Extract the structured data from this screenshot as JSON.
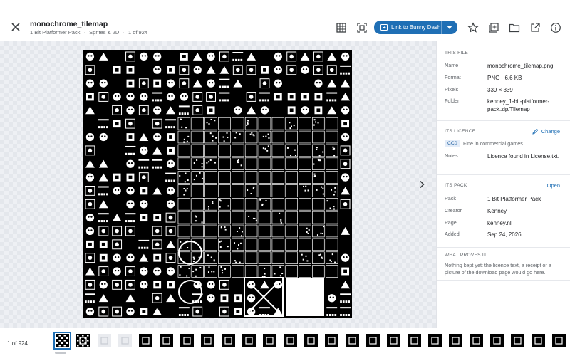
{
  "header": {
    "title": "monochrome_tilemap",
    "subtitle_parts": [
      "1 Bit Platformer Pack",
      "·",
      "Sprites & 2D",
      "·",
      "1 of 924"
    ],
    "link_button_label": "Link to Bunny Dash"
  },
  "icons": {
    "close": "close-icon",
    "grid": "grid-icon",
    "fit": "fit-screen-icon",
    "link": "link-icon",
    "caret": "chevron-down-icon",
    "star": "star-icon",
    "copy": "collection-icon",
    "folder": "folder-icon",
    "open_external": "open-external-icon",
    "info": "info-icon",
    "next": "chevron-right-icon",
    "edit": "pencil-icon"
  },
  "panel": {
    "this_file": {
      "heading": "THIS FILE",
      "rows": [
        {
          "key": "Name",
          "value": "monochrome_tilemap.png"
        },
        {
          "key": "Format",
          "value": "PNG · 6.6 KB"
        },
        {
          "key": "Pixels",
          "value": "339 × 339"
        },
        {
          "key": "Folder",
          "value": "kenney_1-bit-platformer-pack.zip/Tilemap"
        }
      ]
    },
    "licence": {
      "heading": "ITS LICENCE",
      "action": "Change",
      "badge": "CC0",
      "badge_text": "Fine in commercial games.",
      "notes_key": "Notes",
      "notes_value": "Licence found in License.txt."
    },
    "pack": {
      "heading": "ITS PACK",
      "action": "Open",
      "rows": [
        {
          "key": "Pack",
          "value": "1 Bit Platformer Pack"
        },
        {
          "key": "Creator",
          "value": "Kenney"
        },
        {
          "key": "Page",
          "value": "kenney.nl"
        },
        {
          "key": "Added",
          "value": "Sep 24, 2026"
        }
      ]
    },
    "proves": {
      "heading": "WHAT PROVES IT",
      "text": "Nothing kept yet: the licence text, a receipt or a picture of the download page would go here."
    }
  },
  "filmstrip": {
    "counter": "1 of 924",
    "selected_index": 0
  },
  "colors": {
    "accent": "#1f6fb5",
    "badge_bg": "#e3ecf8"
  }
}
